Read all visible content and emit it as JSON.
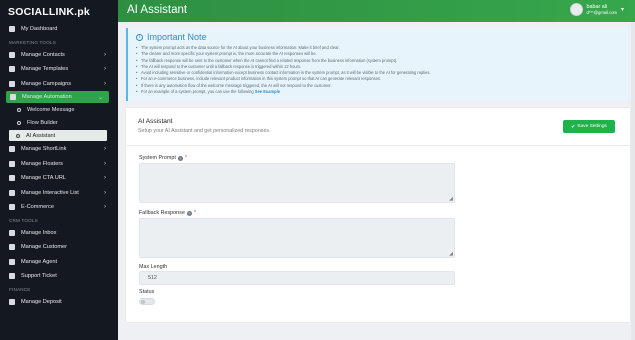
{
  "brand": "SOCIALLINK.pk",
  "sidebar": {
    "items": [
      {
        "label": "My Dashboard",
        "type": "item"
      },
      {
        "label": "MARKETING TOOLS",
        "type": "section"
      },
      {
        "label": "Manage Contacts",
        "type": "item",
        "chevron": true
      },
      {
        "label": "Manage Templates",
        "type": "item",
        "chevron": true
      },
      {
        "label": "Manage Campaigns",
        "type": "item",
        "chevron": true
      },
      {
        "label": "Manage Automation",
        "type": "active",
        "chevron": true
      },
      {
        "label": "Welcome Message",
        "type": "sub"
      },
      {
        "label": "Flow Builder",
        "type": "sub"
      },
      {
        "label": "AI Assistant",
        "type": "sub-selected"
      },
      {
        "label": "Manage ShortLink",
        "type": "item",
        "chevron": true
      },
      {
        "label": "Manage Floaters",
        "type": "item",
        "chevron": true
      },
      {
        "label": "Manage CTA URL",
        "type": "item",
        "chevron": true
      },
      {
        "label": "Manage Interactive List",
        "type": "item",
        "chevron": true
      },
      {
        "label": "E-Commerce",
        "type": "item",
        "chevron": true
      },
      {
        "label": "CRM TOOLS",
        "type": "section"
      },
      {
        "label": "Manage Inbox",
        "type": "item"
      },
      {
        "label": "Manage Customer",
        "type": "item"
      },
      {
        "label": "Manage Agent",
        "type": "item"
      },
      {
        "label": "Support Ticket",
        "type": "item"
      },
      {
        "label": "FINANCE",
        "type": "section"
      },
      {
        "label": "Manage Deposit",
        "type": "item"
      }
    ]
  },
  "header": {
    "title": "AI Assistant",
    "user_name": "babar ali",
    "user_email": "d***@gmail.com"
  },
  "note": {
    "title": "Important Note",
    "lines": [
      "The system prompt acts as the data source for the AI about your business information. Make it brief and clear.",
      "The clearer and more specific your system prompt is, the more accurate the AI responses will be.",
      "The fallback response will be sent to the customer when the AI cannot find a related response from the business information (system prompt).",
      "The AI will respond to the customer until a fallback response is triggered within 12 hours.",
      "Avoid including sensitive or confidential information except business contact information in the system prompt, as it will be visible to the AI for generating replies.",
      "For an e-commerce business, include relevant product information in this system prompt so that AI can generate relevant responses.",
      "If there is any automation flow of the welcome message triggered, the AI will not respond to the customer."
    ],
    "last_line_prefix": "For an example of a system prompt, you can use the following",
    "example_link": "See Example"
  },
  "card": {
    "title": "AI Assistant",
    "subtitle": "Setup your AI Assistant and get personalized responses.",
    "save_label": "Save Settings",
    "system_prompt_label": "System Prompt",
    "fallback_label": "Fallback Response",
    "max_length_label": "Max Length",
    "max_length_value": "512",
    "status_label": "Status",
    "required_mark": "*"
  }
}
